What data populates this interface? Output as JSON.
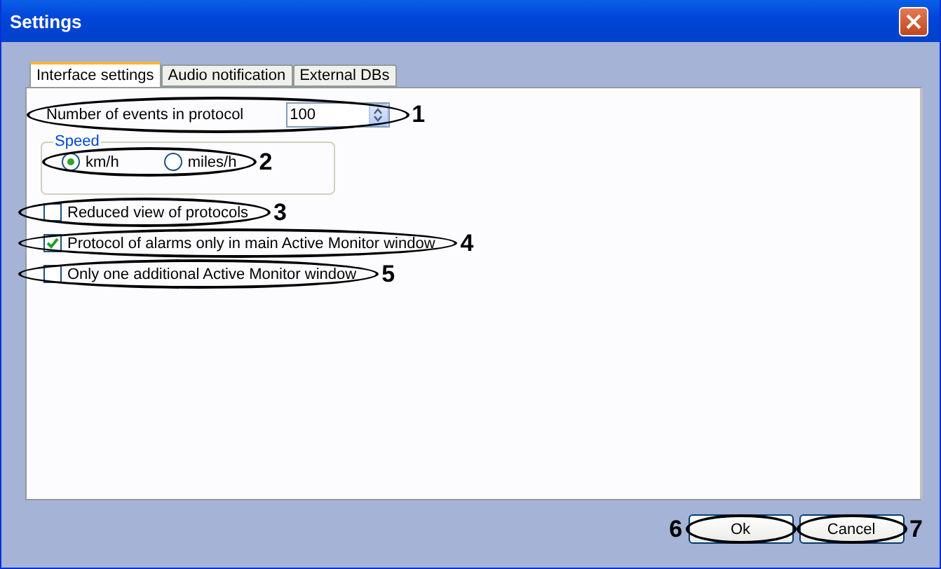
{
  "window": {
    "title": "Settings"
  },
  "tabs": [
    {
      "label": "Interface settings",
      "selected": true
    },
    {
      "label": "Audio notification",
      "selected": false
    },
    {
      "label": "External DBs",
      "selected": false
    }
  ],
  "events_field": {
    "label": "Number of events in protocol",
    "value": "100",
    "callout": "1"
  },
  "speed": {
    "title": "Speed",
    "callout": "2",
    "options": [
      {
        "label": "km/h",
        "selected": true
      },
      {
        "label": "miles/h",
        "selected": false
      }
    ]
  },
  "checkboxes": [
    {
      "label": "Reduced view of protocols",
      "checked": false,
      "callout": "3"
    },
    {
      "label": "Protocol of alarms only in main Active Monitor window",
      "checked": true,
      "callout": "4"
    },
    {
      "label": "Only one additional Active Monitor window",
      "checked": false,
      "callout": "5"
    }
  ],
  "buttons": [
    {
      "label": "Ok",
      "callout": "6"
    },
    {
      "label": "Cancel",
      "callout": "7"
    }
  ]
}
